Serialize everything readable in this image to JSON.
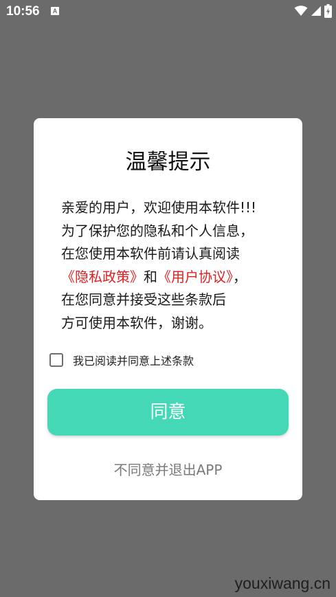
{
  "status_bar": {
    "time": "10:56",
    "notification_icon": "A",
    "icons": [
      "wifi-icon",
      "signal-icon",
      "battery-charging-icon"
    ]
  },
  "dialog": {
    "title": "温馨提示",
    "body_lines": [
      "亲爱的用户，欢迎使用本软件!!!",
      "为了保护您的隐私和个人信息，",
      "在您使用本软件前请认真阅读",
      "",
      "在您同意并接受这些条款后",
      "方可使用本软件，谢谢。"
    ],
    "privacy_link": "《隐私政策》",
    "link_joiner": "和",
    "agreement_link": "《用户协议》",
    "link_suffix": "，",
    "checkbox_label": "我已阅读并同意上述条款",
    "checkbox_checked": false,
    "agree_button": "同意",
    "exit_link": "不同意并退出APP"
  },
  "colors": {
    "accent": "#45d8b6",
    "link": "#e02020",
    "overlay": "#6b6b6b"
  },
  "watermark": "youxiwang.cn"
}
